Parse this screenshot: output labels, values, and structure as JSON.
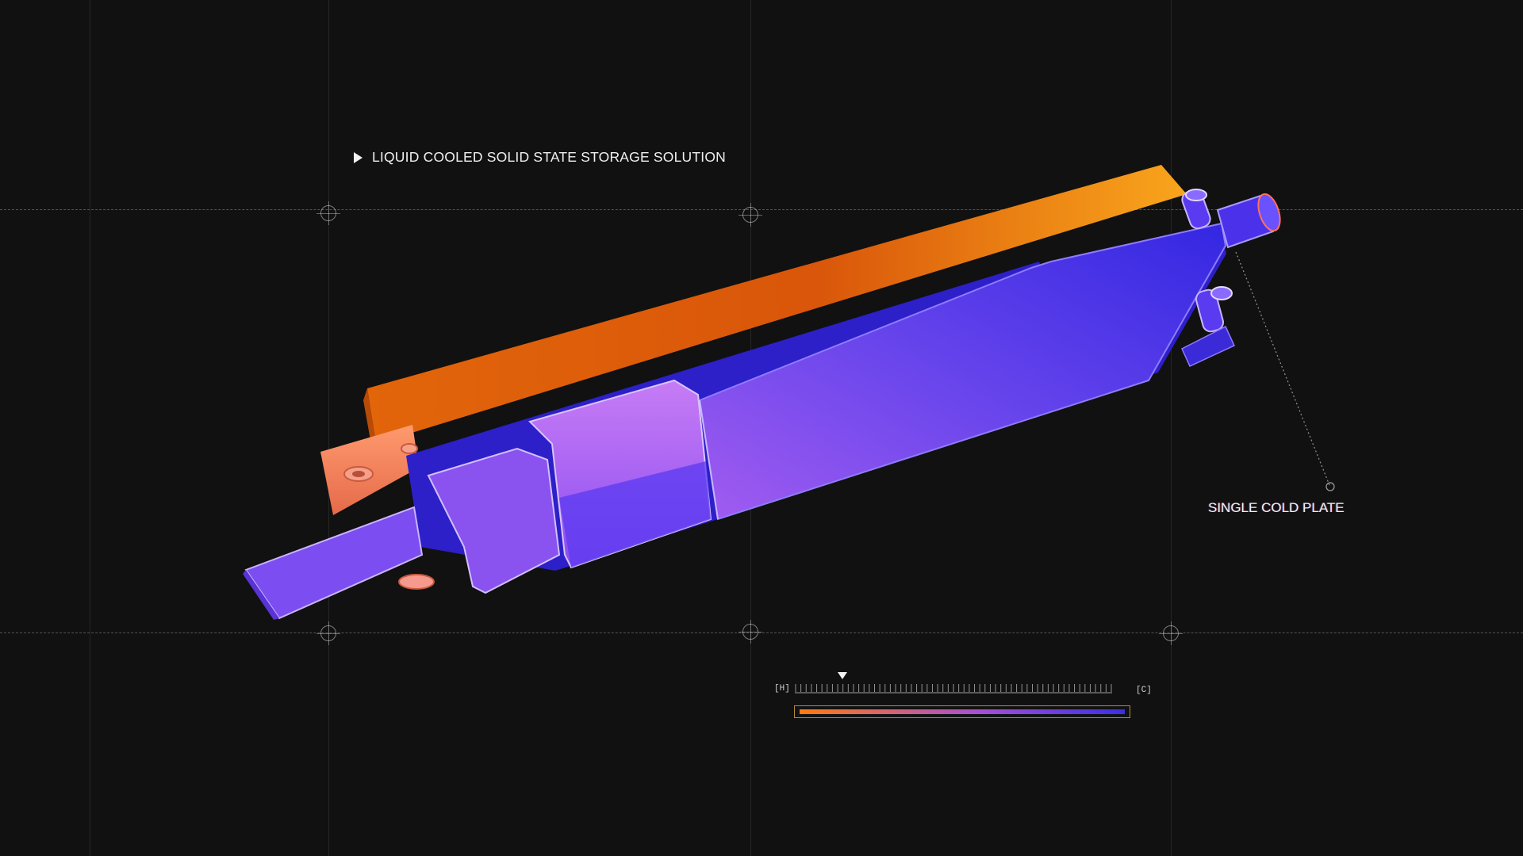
{
  "headline": {
    "text": "LIQUID COOLED SOLID STATE STORAGE SOLUTION",
    "icon": "play-icon"
  },
  "callout": {
    "text": "SINGLE COLD PLATE"
  },
  "temperature_scale": {
    "hot_label": "[H]",
    "cold_label": "[C]",
    "marker_fraction": 0.15,
    "tick_count": 60,
    "colors": {
      "hot": "#ff7a10",
      "mid": "#a64fd6",
      "cold": "#3a2fe6",
      "frame": "#b88a3a"
    }
  },
  "device": {
    "colors": {
      "rail_top": "#f9a51c",
      "rail_bottom": "#e2650a",
      "plate_light": "#8a5df0",
      "plate_dark": "#3228e0",
      "module": "#b56ff0"
    }
  }
}
